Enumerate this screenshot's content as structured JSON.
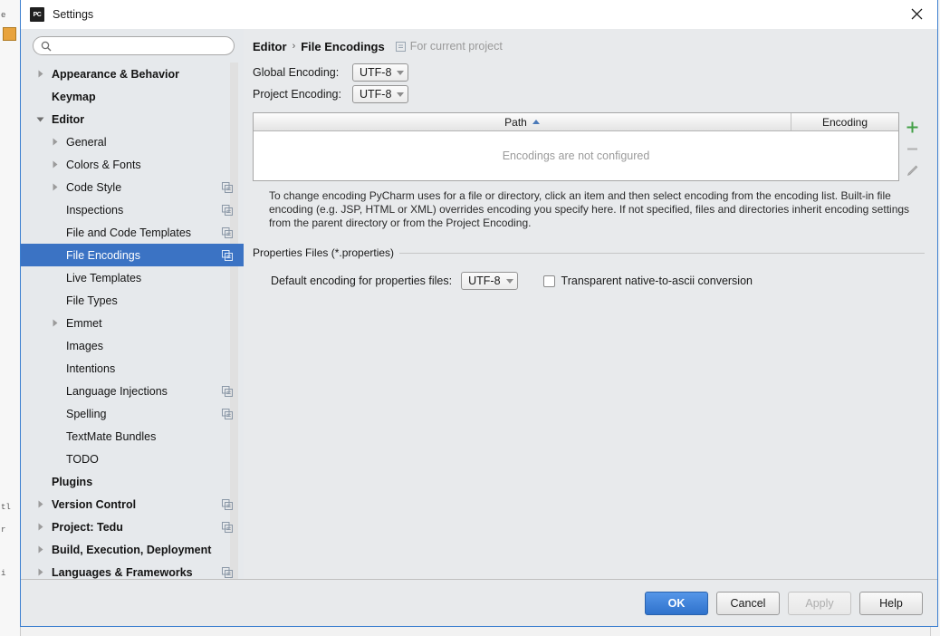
{
  "window": {
    "title": "Settings",
    "logo_text": "PC",
    "close_label": "close-icon"
  },
  "sidebar": {
    "search": {
      "value": "",
      "placeholder": ""
    },
    "items": [
      {
        "label": "Appearance & Behavior",
        "level": 0,
        "twisty": "collapsed",
        "config_icon": false,
        "selected": false
      },
      {
        "label": "Keymap",
        "level": 0,
        "twisty": "none",
        "config_icon": false,
        "selected": false
      },
      {
        "label": "Editor",
        "level": 0,
        "twisty": "expanded",
        "config_icon": false,
        "selected": false
      },
      {
        "label": "General",
        "level": 1,
        "twisty": "collapsed",
        "config_icon": false,
        "selected": false
      },
      {
        "label": "Colors & Fonts",
        "level": 1,
        "twisty": "collapsed",
        "config_icon": false,
        "selected": false
      },
      {
        "label": "Code Style",
        "level": 1,
        "twisty": "collapsed",
        "config_icon": true,
        "selected": false
      },
      {
        "label": "Inspections",
        "level": 1,
        "twisty": "none",
        "config_icon": true,
        "selected": false
      },
      {
        "label": "File and Code Templates",
        "level": 1,
        "twisty": "none",
        "config_icon": true,
        "selected": false
      },
      {
        "label": "File Encodings",
        "level": 1,
        "twisty": "none",
        "config_icon": true,
        "selected": true
      },
      {
        "label": "Live Templates",
        "level": 1,
        "twisty": "none",
        "config_icon": false,
        "selected": false
      },
      {
        "label": "File Types",
        "level": 1,
        "twisty": "none",
        "config_icon": false,
        "selected": false
      },
      {
        "label": "Emmet",
        "level": 1,
        "twisty": "collapsed",
        "config_icon": false,
        "selected": false
      },
      {
        "label": "Images",
        "level": 1,
        "twisty": "none",
        "config_icon": false,
        "selected": false
      },
      {
        "label": "Intentions",
        "level": 1,
        "twisty": "none",
        "config_icon": false,
        "selected": false
      },
      {
        "label": "Language Injections",
        "level": 1,
        "twisty": "none",
        "config_icon": true,
        "selected": false
      },
      {
        "label": "Spelling",
        "level": 1,
        "twisty": "none",
        "config_icon": true,
        "selected": false
      },
      {
        "label": "TextMate Bundles",
        "level": 1,
        "twisty": "none",
        "config_icon": false,
        "selected": false
      },
      {
        "label": "TODO",
        "level": 1,
        "twisty": "none",
        "config_icon": false,
        "selected": false
      },
      {
        "label": "Plugins",
        "level": 0,
        "twisty": "none",
        "config_icon": false,
        "selected": false
      },
      {
        "label": "Version Control",
        "level": 0,
        "twisty": "collapsed",
        "config_icon": true,
        "selected": false
      },
      {
        "label": "Project: Tedu",
        "level": 0,
        "twisty": "collapsed",
        "config_icon": true,
        "selected": false
      },
      {
        "label": "Build, Execution, Deployment",
        "level": 0,
        "twisty": "collapsed",
        "config_icon": false,
        "selected": false
      },
      {
        "label": "Languages & Frameworks",
        "level": 0,
        "twisty": "collapsed",
        "config_icon": true,
        "selected": false
      }
    ]
  },
  "main": {
    "breadcrumb": {
      "parent": "Editor",
      "separator": "›",
      "current": "File Encodings"
    },
    "scope_note": "For current project",
    "global_encoding": {
      "label": "Global Encoding:",
      "value": "UTF-8"
    },
    "project_encoding": {
      "label": "Project Encoding:",
      "value": "UTF-8"
    },
    "table": {
      "columns": [
        "Path",
        "Encoding"
      ],
      "sort_column": "Path",
      "sort_direction": "ascending",
      "rows": [],
      "empty_message": "Encodings are not configured"
    },
    "table_tools": [
      {
        "name": "add",
        "glyph": "+"
      },
      {
        "name": "remove",
        "glyph": "−"
      },
      {
        "name": "edit",
        "glyph": "pencil"
      }
    ],
    "description": "To change encoding PyCharm uses for a file or directory, click an item and then select encoding from the encoding list. Built-in file encoding (e.g. JSP, HTML or XML) overrides encoding you specify here. If not specified, files and directories inherit encoding settings from the parent directory or from the Project Encoding.",
    "properties_group": {
      "title": "Properties Files (*.properties)",
      "default_encoding_label": "Default encoding for properties files:",
      "default_encoding_value": "UTF-8",
      "native_ascii_label": "Transparent native-to-ascii conversion",
      "native_ascii_checked": false
    }
  },
  "footer": {
    "buttons": [
      {
        "label": "OK",
        "style": "primary",
        "enabled": true
      },
      {
        "label": "Cancel",
        "style": "normal",
        "enabled": true
      },
      {
        "label": "Apply",
        "style": "normal",
        "enabled": false
      },
      {
        "label": "Help",
        "style": "normal",
        "enabled": true
      }
    ]
  },
  "colors": {
    "selection_blue": "#3b73c4",
    "primary_button": "#2f72cc",
    "add_icon_green": "#43a047",
    "sort_arrow_blue": "#4a79b8",
    "dialog_border": "#3c7fd0"
  }
}
